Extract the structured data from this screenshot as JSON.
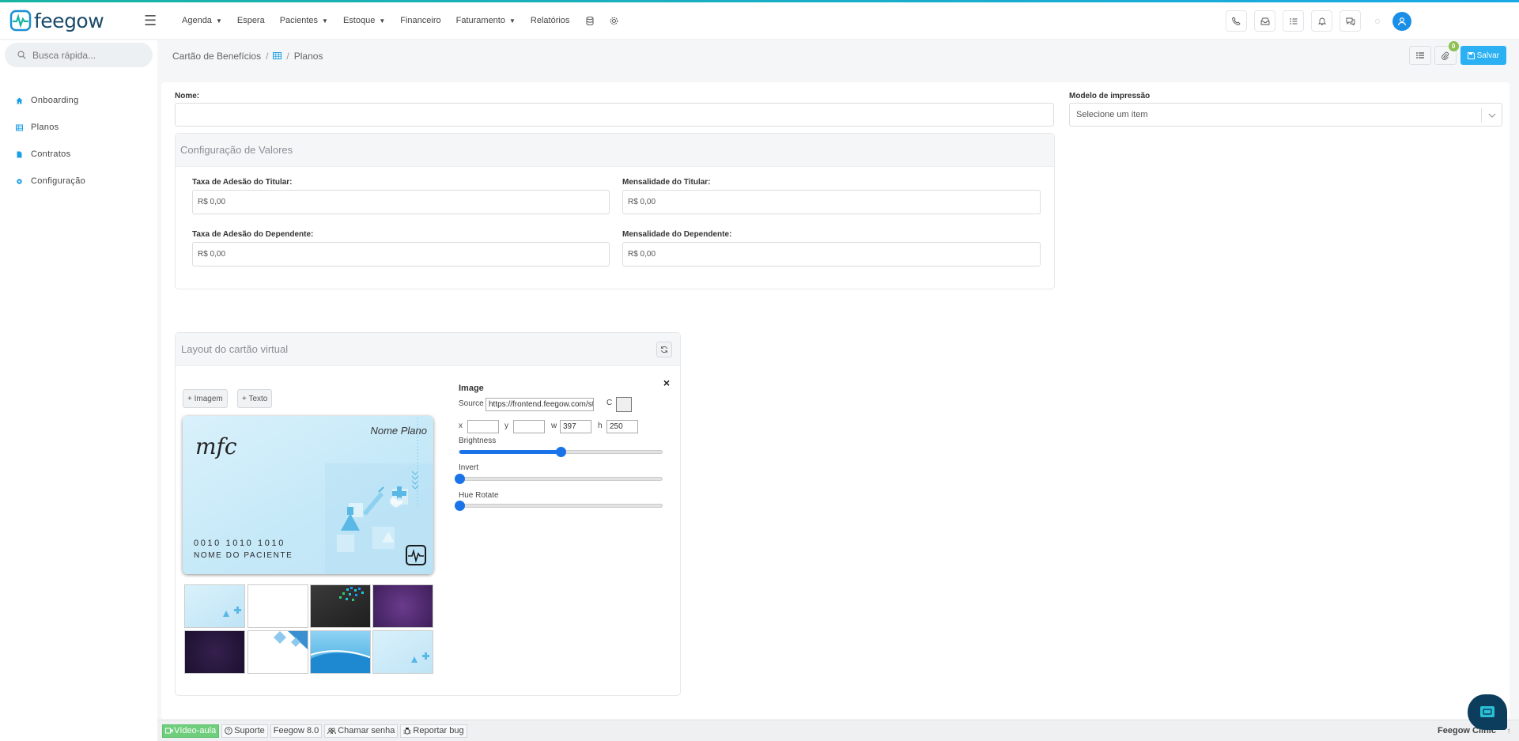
{
  "app": {
    "logo": "feegow"
  },
  "menu": {
    "items": [
      {
        "label": "Agenda",
        "dropdown": true
      },
      {
        "label": "Espera",
        "dropdown": false
      },
      {
        "label": "Pacientes",
        "dropdown": true
      },
      {
        "label": "Estoque",
        "dropdown": true
      },
      {
        "label": "Financeiro",
        "dropdown": false
      },
      {
        "label": "Faturamento",
        "dropdown": true
      },
      {
        "label": "Relatórios",
        "dropdown": false
      }
    ]
  },
  "search": {
    "placeholder": "Busca rápida..."
  },
  "sidebar": {
    "items": [
      {
        "label": "Onboarding",
        "icon": "home-icon"
      },
      {
        "label": "Planos",
        "icon": "table-icon"
      },
      {
        "label": "Contratos",
        "icon": "document-icon"
      },
      {
        "label": "Configuração",
        "icon": "gear-icon"
      }
    ]
  },
  "breadcrumb": {
    "root": "Cartão de Benefícios",
    "current": "Planos"
  },
  "actions": {
    "badge_count": "0",
    "save_label": "Salvar"
  },
  "form": {
    "nome_label": "Nome:",
    "nome_value": "",
    "modelo_label": "Modelo de impressão",
    "modelo_placeholder": "Selecione um item"
  },
  "valores": {
    "title": "Configuração de Valores",
    "taxa_titular_label": "Taxa de Adesão do Titular:",
    "taxa_titular_value": "R$ 0,00",
    "mensal_titular_label": "Mensalidade do Titular:",
    "mensal_titular_value": "R$ 0,00",
    "taxa_dep_label": "Taxa de Adesão do Dependente:",
    "taxa_dep_value": "R$ 0,00",
    "mensal_dep_label": "Mensalidade do Dependente:",
    "mensal_dep_value": "R$ 0,00"
  },
  "layout": {
    "title": "Layout do cartão virtual",
    "close": "×",
    "add_image": "+ Imagem",
    "add_text": "+ Texto",
    "card": {
      "plan_name": "Nome Plano",
      "logo_text": "mfc",
      "card_number": "0010 1010 1010",
      "patient_name": "NOME DO PACIENTE"
    },
    "editor": {
      "title": "Image",
      "source_label": "Source",
      "source_value": "https://frontend.feegow.com/static/m",
      "c_label": "C",
      "x_label": "x",
      "x_value": "",
      "y_label": "y",
      "y_value": "",
      "w_label": "w",
      "w_value": "397",
      "h_label": "h",
      "h_value": "250",
      "brightness_label": "Brightness",
      "brightness_level": 0.5,
      "invert_label": "Invert",
      "invert_level": 0,
      "hue_label": "Hue Rotate",
      "hue_level": 0
    }
  },
  "footer": {
    "video": "Vídeo-aula",
    "suporte": "Suporte",
    "version": "Feegow 8.0",
    "chamar": "Chamar senha",
    "bug": "Reportar bug",
    "brand": "Feegow Clinic"
  },
  "colors": {
    "accent": "#2bb1f3",
    "brand": "#1b4a6b",
    "green": "#6fce7c"
  }
}
